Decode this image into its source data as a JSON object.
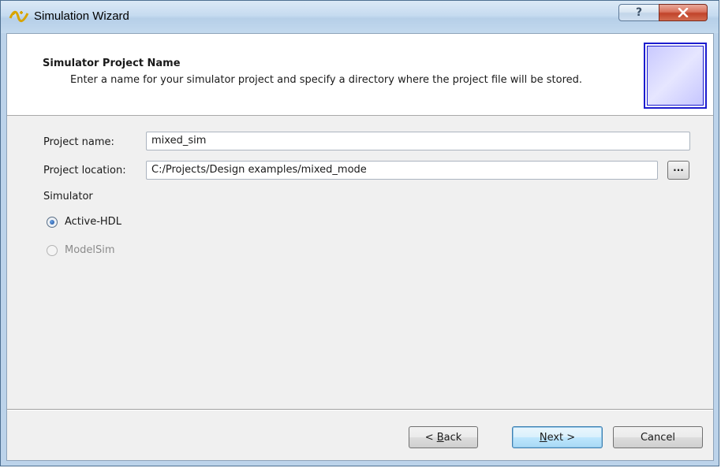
{
  "window": {
    "title": "Simulation Wizard",
    "help_glyph": "?",
    "close_glyph": "X"
  },
  "header": {
    "title": "Simulator Project Name",
    "subtitle": "Enter a name for your simulator project and specify a directory where the project file will be stored."
  },
  "form": {
    "project_name_label": "Project name:",
    "project_name_value": "mixed_sim",
    "project_location_label": "Project location:",
    "project_location_value": "C:/Projects/Design examples/mixed_mode",
    "browse_label": "...",
    "simulator_label": "Simulator",
    "simulators": [
      {
        "label": "Active-HDL",
        "selected": true,
        "enabled": true
      },
      {
        "label": "ModelSim",
        "selected": false,
        "enabled": false
      }
    ]
  },
  "footer": {
    "back_prefix": "< ",
    "back_mnemonic": "B",
    "back_rest": "ack",
    "next_mnemonic": "N",
    "next_rest": "ext >",
    "cancel_label": "Cancel"
  },
  "colors": {
    "accent": "#3c7fb1",
    "titlebar": "#c6dbf0",
    "close": "#c1432a",
    "header_art_border": "#1c1ccf"
  }
}
